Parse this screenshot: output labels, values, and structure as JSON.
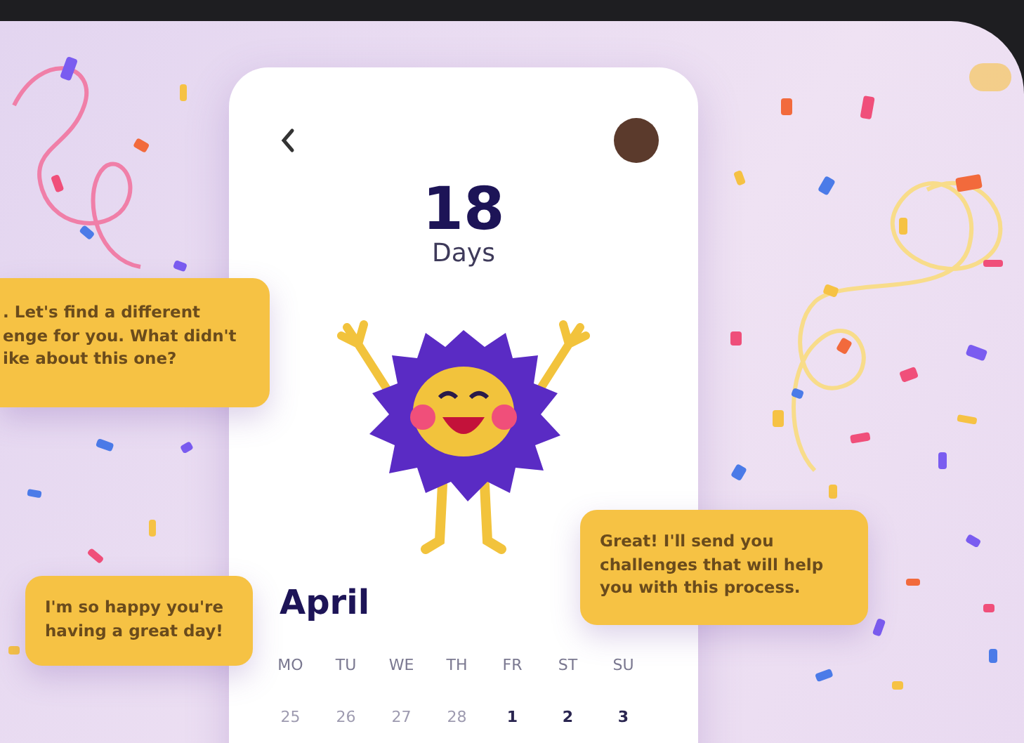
{
  "phone": {
    "count": "18",
    "count_label": "Days",
    "month": "April",
    "weekdays": [
      "MO",
      "TU",
      "WE",
      "TH",
      "FR",
      "ST",
      "SU"
    ],
    "days": [
      {
        "label": "25",
        "muted": true
      },
      {
        "label": "26",
        "muted": true
      },
      {
        "label": "27",
        "muted": true
      },
      {
        "label": "28",
        "muted": true
      },
      {
        "label": "1",
        "muted": false
      },
      {
        "label": "2",
        "muted": false
      },
      {
        "label": "3",
        "muted": false
      }
    ]
  },
  "bubbles": [
    {
      "text": ". Let's find a different\nenge for you. What didn't\nike about this one?",
      "kind": "left-cut"
    },
    {
      "text": "I'm so happy you're\nhaving a great day!",
      "kind": "left"
    },
    {
      "text": "Great! I'll send you\nchallenges that will help\nyou with this process.",
      "kind": "right"
    }
  ]
}
